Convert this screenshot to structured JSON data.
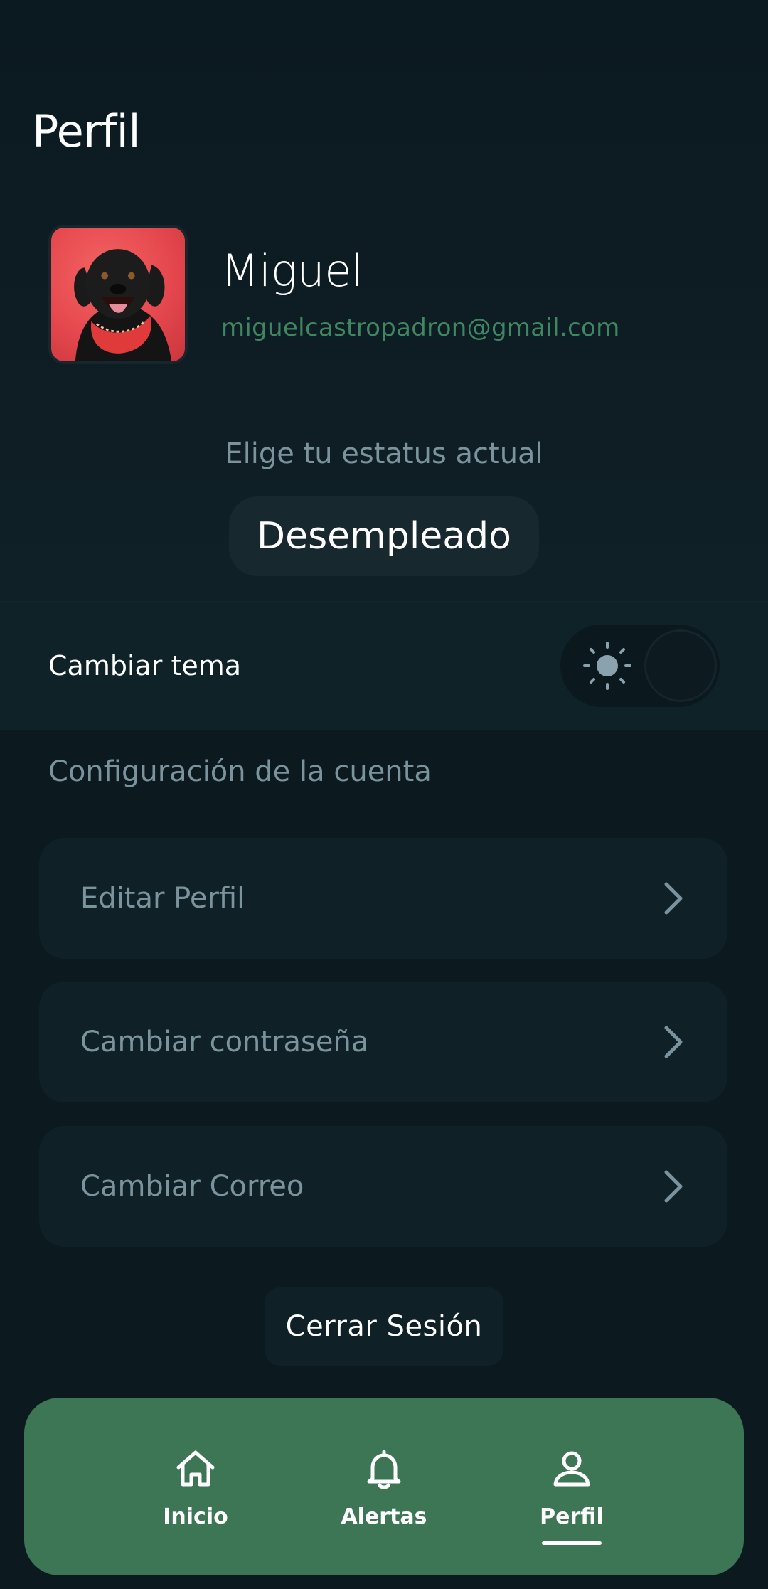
{
  "header": {
    "title": "Perfil"
  },
  "profile": {
    "name": "Miguel",
    "email": "miguelcastropadron@gmail.com"
  },
  "status": {
    "label": "Elige tu estatus actual",
    "current": "Desempleado"
  },
  "theme": {
    "label": "Cambiar tema",
    "icon": "sun-icon",
    "dark_mode_on": false
  },
  "account": {
    "title": "Configuración de la cuenta",
    "items": [
      {
        "label": "Editar Perfil",
        "icon": "chevron-right-icon"
      },
      {
        "label": "Cambiar contraseña",
        "icon": "chevron-right-icon"
      },
      {
        "label": "Cambiar Correo",
        "icon": "chevron-right-icon"
      }
    ]
  },
  "logout": {
    "label": "Cerrar Sesión"
  },
  "nav": {
    "items": [
      {
        "label": "Inicio",
        "icon": "home-icon",
        "active": false
      },
      {
        "label": "Alertas",
        "icon": "bell-icon",
        "active": false
      },
      {
        "label": "Perfil",
        "icon": "person-icon",
        "active": true
      }
    ]
  },
  "colors": {
    "background": "#0c1a20",
    "accent_green": "#3d7655",
    "email_green": "#3f8760",
    "muted_text": "#7b939d",
    "card": "#0f2127"
  }
}
